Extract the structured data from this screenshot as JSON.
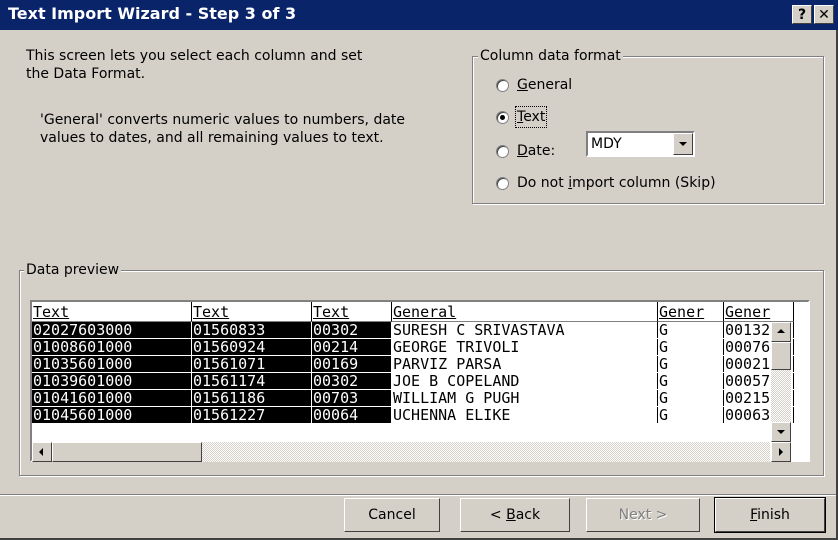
{
  "window": {
    "title": "Text Import Wizard - Step 3 of 3",
    "help_label": "?",
    "close_label": "✕"
  },
  "description": {
    "line1": "This screen lets you select each column and set",
    "line2": "the Data Format.",
    "line3": "'General' converts numeric values to numbers, date",
    "line4": "values to dates, and all remaining values to text."
  },
  "column_format": {
    "legend": "Column data format",
    "options": [
      {
        "label": "General",
        "mnemonic": "G",
        "rest": "eneral",
        "selected": false
      },
      {
        "label": "Text",
        "mnemonic": "T",
        "rest": "ext",
        "selected": true
      },
      {
        "label": "Date:",
        "mnemonic": "D",
        "rest": "ate:",
        "selected": false
      },
      {
        "label": "Do not import column (Skip)",
        "pre": "Do not ",
        "mnemonic": "i",
        "rest": "mport column (Skip)",
        "selected": false
      }
    ],
    "date_format": "MDY"
  },
  "preview": {
    "legend": "Data preview",
    "columns": [
      {
        "header": "Text",
        "selected": true
      },
      {
        "header": "Text",
        "selected": true
      },
      {
        "header": "Text",
        "selected": true
      },
      {
        "header": "General",
        "selected": false
      },
      {
        "header": "Gener",
        "selected": false
      },
      {
        "header": "Gener",
        "selected": false
      }
    ],
    "rows": [
      [
        "02027603000",
        "01560833",
        "00302",
        "SURESH C SRIVASTAVA",
        "G",
        "00132"
      ],
      [
        "01008601000",
        "01560924",
        "00214",
        "GEORGE TRIVOLI",
        "G",
        "00076"
      ],
      [
        "01035601000",
        "01561071",
        "00169",
        "PARVIZ PARSA",
        "G",
        "00021"
      ],
      [
        "01039601000",
        "01561174",
        "00302",
        "JOE B COPELAND",
        "G",
        "00057"
      ],
      [
        "01041601000",
        "01561186",
        "00703",
        "WILLIAM G PUGH",
        "G",
        "00215"
      ],
      [
        "01045601000",
        "01561227",
        "00064",
        "UCHENNA ELIKE",
        "G",
        "00063"
      ]
    ]
  },
  "buttons": {
    "cancel": "Cancel",
    "back": "< Back",
    "back_pre": "< ",
    "back_mnemonic": "B",
    "back_rest": "ack",
    "next": "Next >",
    "finish": "Finish",
    "finish_mnemonic": "F",
    "finish_rest": "inish"
  },
  "icons": {
    "help": "help-icon",
    "close": "close-icon",
    "dropdown": "chevron-down-icon",
    "scroll_up": "arrow-up-icon",
    "scroll_down": "arrow-down-icon",
    "scroll_left": "arrow-left-icon",
    "scroll_right": "arrow-right-icon"
  },
  "colors": {
    "titlebar": "#0a246a",
    "face": "#d4d0c8",
    "selected_column": "#000000"
  }
}
